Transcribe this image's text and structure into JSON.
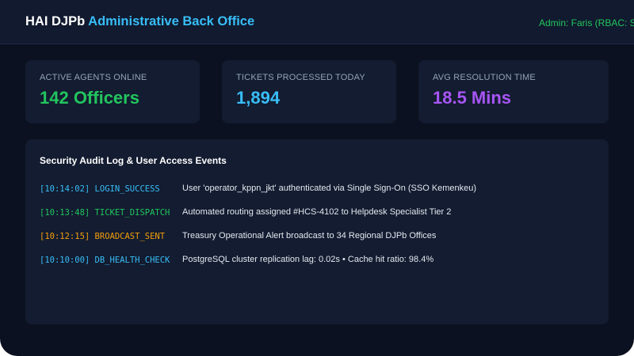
{
  "header": {
    "brand_name": "HAI DJPb",
    "brand_subtitle": "Administrative Back Office",
    "admin_label": "Admin: Faris (RBAC: S"
  },
  "stats": [
    {
      "label": "ACTIVE AGENTS ONLINE",
      "value": "142 Officers",
      "color": "#22c55e"
    },
    {
      "label": "TICKETS PROCESSED TODAY",
      "value": "1,894",
      "color": "#38bdf8"
    },
    {
      "label": "AVG RESOLUTION TIME",
      "value": "18.5 Mins",
      "color": "#a855f7"
    }
  ],
  "audit_log": {
    "title": "Security Audit Log & User Access Events",
    "entries": [
      {
        "time": "[10:14:02]",
        "event": "LOGIN_SUCCESS",
        "message": "User 'operator_kppn_jkt' authenticated via Single Sign-On (SSO Kemenkeu)",
        "color": "#38bdf8"
      },
      {
        "time": "[10:13:48]",
        "event": "TICKET_DISPATCH",
        "message": "Automated routing assigned #HCS-4102 to Helpdesk Specialist Tier 2",
        "color": "#22c55e"
      },
      {
        "time": "[10:12:15]",
        "event": "BROADCAST_SENT",
        "message": "Treasury Operational Alert broadcast to 34 Regional DJPb Offices",
        "color": "#f59e0b"
      },
      {
        "time": "[10:10:00]",
        "event": "DB_HEALTH_CHECK",
        "message": "PostgreSQL cluster replication lag: 0.02s • Cache hit ratio: 98.4%",
        "color": "#38bdf8"
      }
    ]
  }
}
